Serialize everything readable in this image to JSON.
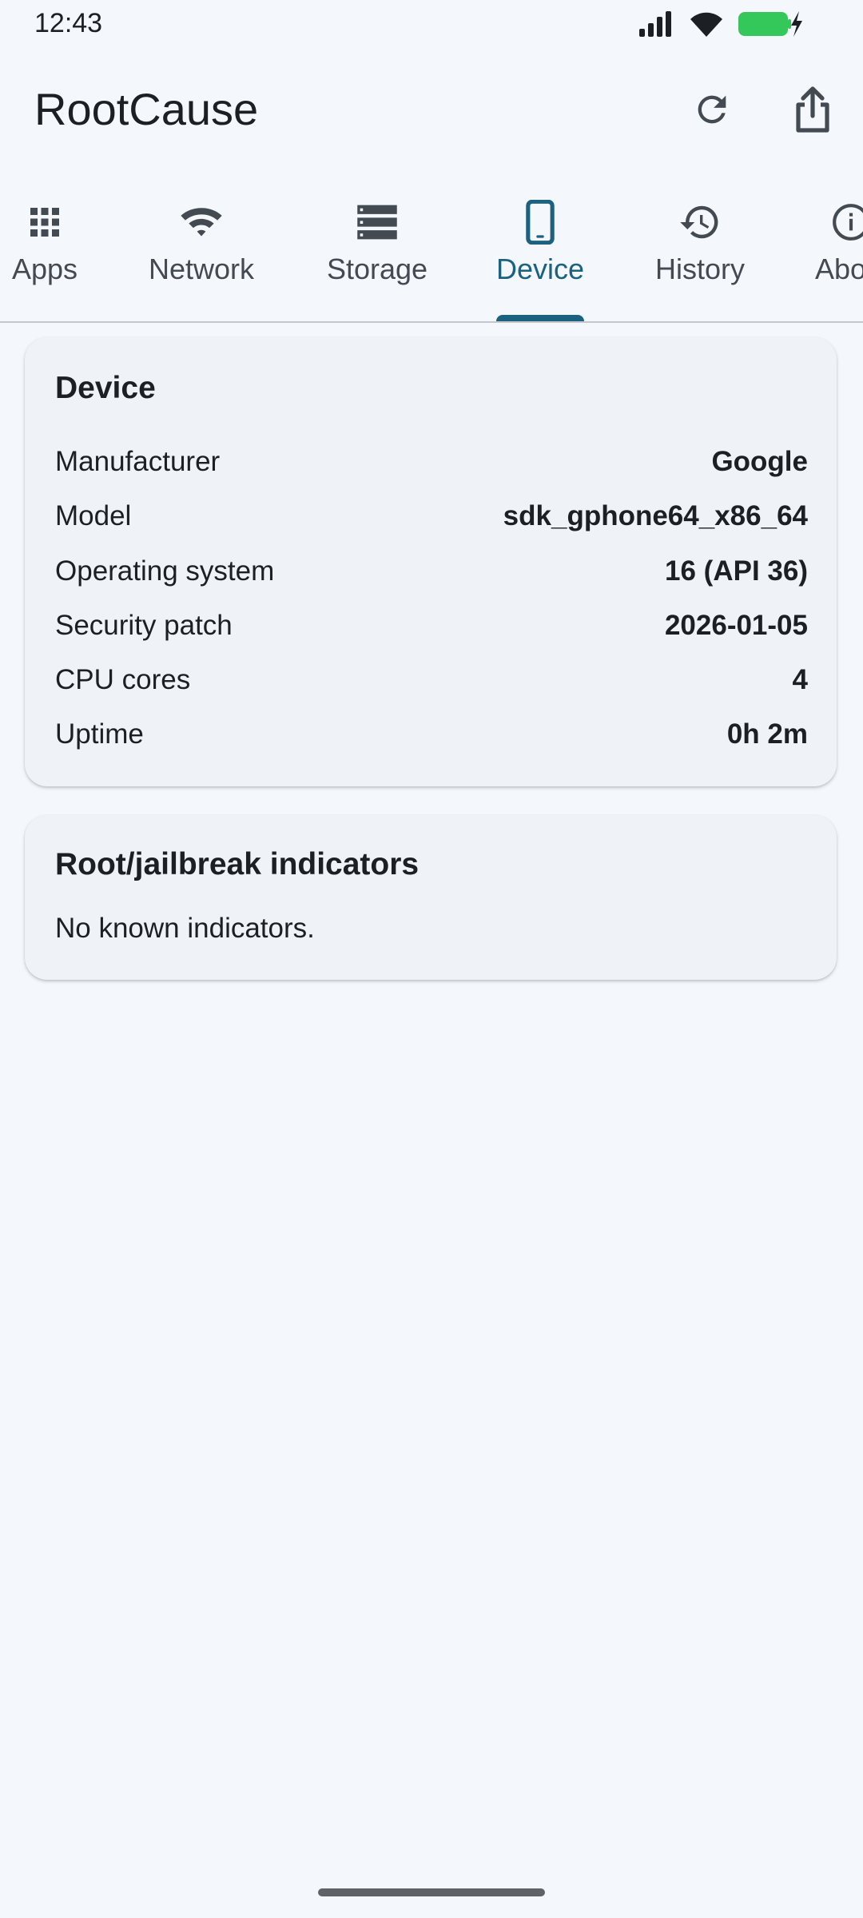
{
  "status_bar": {
    "time": "12:43",
    "icons": [
      "signal-icon",
      "wifi-icon",
      "battery-charging-icon"
    ],
    "battery_color": "#34c759"
  },
  "app_bar": {
    "title": "RootCause",
    "actions": [
      "refresh-icon",
      "share-icon"
    ]
  },
  "tabs": [
    {
      "label": "Apps",
      "icon": "apps-grid-icon",
      "active": false
    },
    {
      "label": "Network",
      "icon": "wifi-icon",
      "active": false
    },
    {
      "label": "Storage",
      "icon": "storage-icon",
      "active": false
    },
    {
      "label": "Device",
      "icon": "smartphone-icon",
      "active": true
    },
    {
      "label": "History",
      "icon": "history-icon",
      "active": false
    },
    {
      "label": "About",
      "icon": "info-icon",
      "active": false
    }
  ],
  "colors": {
    "accent": "#1b6180",
    "background": "#f4f7fb",
    "card": "#eff2f6",
    "text": "#1c1f23",
    "secondary_text": "#434a52"
  },
  "device_card": {
    "title": "Device",
    "rows": [
      {
        "label": "Manufacturer",
        "value": "Google"
      },
      {
        "label": "Model",
        "value": "sdk_gphone64_x86_64"
      },
      {
        "label": "Operating system",
        "value": "16 (API 36)"
      },
      {
        "label": "Security patch",
        "value": "2026-01-05"
      },
      {
        "label": "CPU cores",
        "value": "4"
      },
      {
        "label": "Uptime",
        "value": "0h 2m"
      }
    ]
  },
  "root_card": {
    "title": "Root/jailbreak indicators",
    "text": "No known indicators."
  }
}
